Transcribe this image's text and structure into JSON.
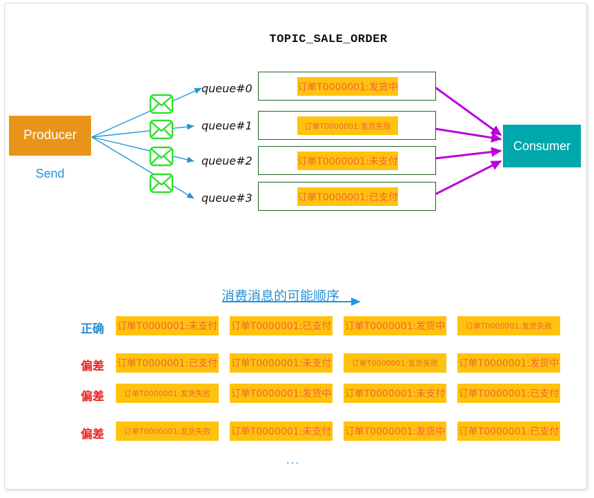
{
  "diagram": {
    "topic_title": "TOPIC_SALE_ORDER",
    "producer": {
      "label": "Producer",
      "action_label": "Send",
      "box_color": "#e8941a",
      "action_color": "#2196d6"
    },
    "consumer": {
      "label": "Consumer",
      "box_color": "#00a8ac"
    },
    "queues": [
      {
        "name": "queue#0",
        "message": "订单T0000001:发货中",
        "size": "normal"
      },
      {
        "name": "queue#1",
        "message": "订单T0000001:发货失败",
        "size": "small"
      },
      {
        "name": "queue#2",
        "message": "订单T0000001:未支付",
        "size": "normal"
      },
      {
        "name": "queue#3",
        "message": "订单T0000001:已支付",
        "size": "normal"
      }
    ],
    "colors": {
      "message_chip_bg": "#ffc20e",
      "message_chip_text": "#f4603e",
      "queue_border": "#1d6121",
      "envelope": "#2ee02e",
      "send_arrow": "#2196d6",
      "consume_arrow": "#bb00dd"
    }
  },
  "order_section": {
    "title": "消费消息的可能顺序",
    "ellipsis": "...",
    "rows": [
      {
        "label": "正确",
        "kind": "correct",
        "messages": [
          {
            "text": "订单T0000001:未支付",
            "size": "normal"
          },
          {
            "text": "订单T0000001:已支付",
            "size": "normal"
          },
          {
            "text": "订单T0000001:发货中",
            "size": "normal"
          },
          {
            "text": "订单T0000001:发货失败",
            "size": "small"
          }
        ]
      },
      {
        "label": "偏差",
        "kind": "deviation",
        "messages": [
          {
            "text": "订单T0000001:已支付",
            "size": "normal"
          },
          {
            "text": "订单T0000001:未支付",
            "size": "normal"
          },
          {
            "text": "订单T0000001:发货失败",
            "size": "small"
          },
          {
            "text": "订单T0000001:发货中",
            "size": "normal"
          }
        ]
      },
      {
        "label": "偏差",
        "kind": "deviation",
        "messages": [
          {
            "text": "订单T0000001:发货失败",
            "size": "small"
          },
          {
            "text": "订单T0000001:发货中",
            "size": "normal"
          },
          {
            "text": "订单T0000001:未支付",
            "size": "normal"
          },
          {
            "text": "订单T0000001:已支付",
            "size": "normal"
          }
        ]
      },
      {
        "label": "偏差",
        "kind": "deviation",
        "messages": [
          {
            "text": "订单T0000001:发货失败",
            "size": "small"
          },
          {
            "text": "订单T0000001:未支付",
            "size": "normal"
          },
          {
            "text": "订单T0000001:发货中",
            "size": "normal"
          },
          {
            "text": "订单T0000001:已支付",
            "size": "normal"
          }
        ]
      }
    ]
  }
}
